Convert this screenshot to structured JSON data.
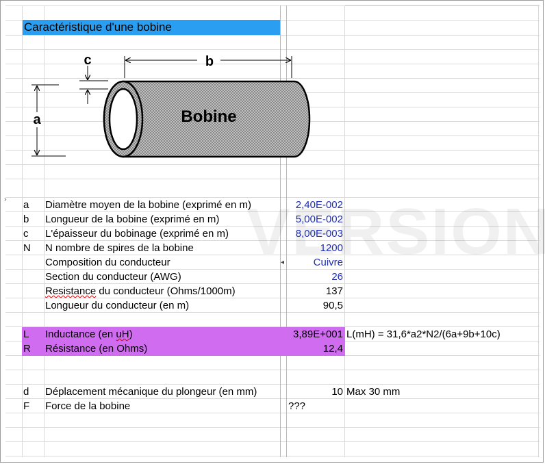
{
  "sheet": {
    "title": "Caractéristique d'une bobine",
    "watermark": "VERSION",
    "diagram": {
      "label_a": "a",
      "label_b": "b",
      "label_c": "c",
      "coil_label": "Bobine"
    },
    "params": [
      {
        "sym": "a",
        "label": "Diamètre moyen de la bobine (exprimé en m)",
        "value": "2,40E-002"
      },
      {
        "sym": "b",
        "label": "Longueur de la bobine (exprimé en m)",
        "value": "5,00E-002"
      },
      {
        "sym": "c",
        "label": "L'épaisseur du bobinage (exprimé en m)",
        "value": "8,00E-003"
      },
      {
        "sym": "N",
        "label": "N nombre de spires de la bobine",
        "value": "1200"
      },
      {
        "sym": "",
        "label": "Composition du conducteur",
        "value": "Cuivre"
      },
      {
        "sym": "",
        "label": "Section du conducteur (AWG)",
        "value": "26"
      },
      {
        "sym": "",
        "label_word": "Resistance",
        "label_rest": " du conducteur (Ohms/1000m)",
        "value": "137"
      },
      {
        "sym": "",
        "label": "Longueur du conducteur (en m)",
        "value": "90,5"
      }
    ],
    "results": [
      {
        "sym": "L",
        "label_pre": "Inductance (en ",
        "label_word": "uH",
        "label_post": ")",
        "value": "3,89E+001",
        "note": "L(mH) = 31,6*a2*N2/(6a+9b+10c)"
      },
      {
        "sym": "R",
        "label": "Résistance (en Ohms)",
        "value": "12,4",
        "note": ""
      }
    ],
    "mech": [
      {
        "sym": "d",
        "label": "Déplacement mécanique du plongeur (en mm)",
        "value": "10",
        "note": "Max 30 mm"
      },
      {
        "sym": "F",
        "label": "Force de la bobine",
        "value": "???",
        "note": ""
      }
    ]
  }
}
